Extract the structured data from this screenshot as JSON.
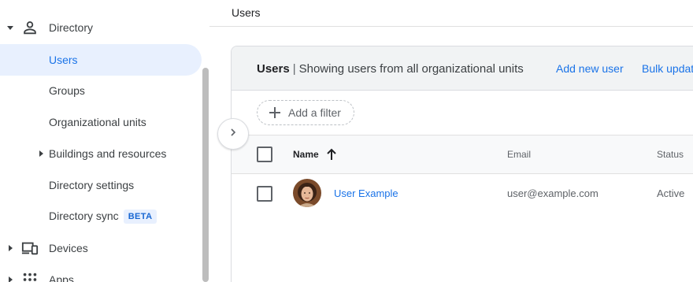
{
  "sidebar": {
    "items": [
      {
        "label": "Directory",
        "icon": "person-icon"
      },
      {
        "label": "Users"
      },
      {
        "label": "Groups"
      },
      {
        "label": "Organizational units"
      },
      {
        "label": "Buildings and resources"
      },
      {
        "label": "Directory settings"
      },
      {
        "label": "Directory sync",
        "badge": "BETA"
      },
      {
        "label": "Devices",
        "icon": "devices-icon"
      },
      {
        "label": "Apps",
        "icon": "apps-grid-icon"
      }
    ],
    "active": "Users",
    "accent_color": "#1a73e8",
    "active_bg": "#e8f0fe"
  },
  "main": {
    "page_title": "Users",
    "card": {
      "title_bold": "Users",
      "separator": "|",
      "subtitle": "Showing users from all organizational units",
      "actions": [
        "Add new user",
        "Bulk updat"
      ]
    },
    "filter": {
      "label": "Add a filter",
      "icon": "plus-icon"
    },
    "table": {
      "columns": [
        "Name",
        "Email",
        "Status"
      ],
      "sort_icon": "arrow-up-icon",
      "rows": [
        {
          "name": "User Example",
          "email": "user@example.com",
          "status": "Active"
        }
      ]
    },
    "expand_icon": "chevron-right-icon"
  }
}
